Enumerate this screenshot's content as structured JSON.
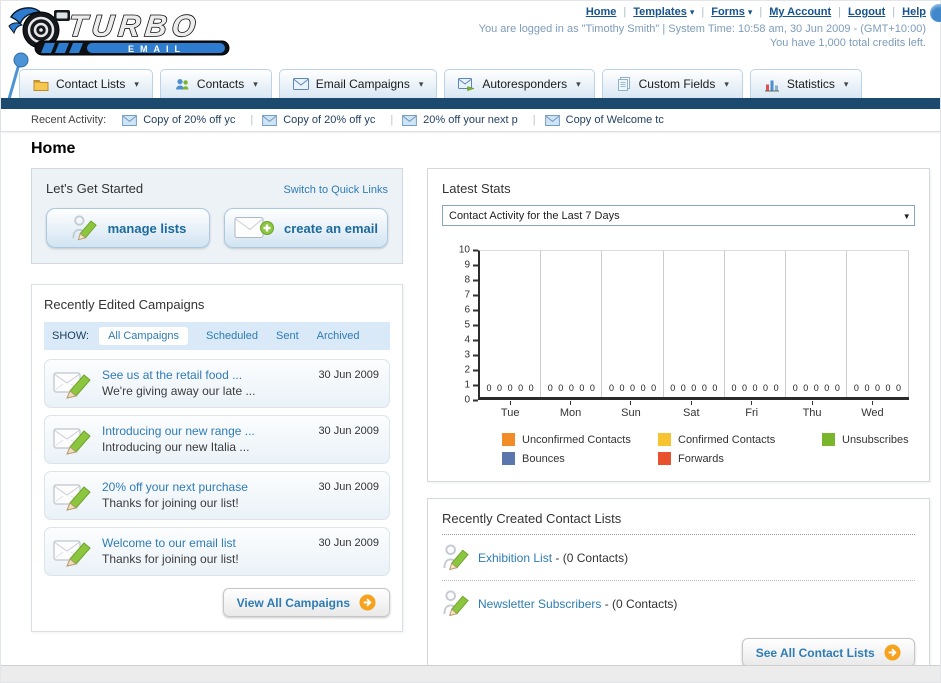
{
  "brand": {
    "title": "TURBO",
    "subtitle": "EMAIL"
  },
  "header": {
    "links": [
      {
        "label": "Home",
        "dropdown": false
      },
      {
        "label": "Templates",
        "dropdown": true
      },
      {
        "label": "Forms",
        "dropdown": true
      },
      {
        "label": "My Account",
        "dropdown": false
      },
      {
        "label": "Logout",
        "dropdown": false
      },
      {
        "label": "Help",
        "dropdown": false
      }
    ],
    "status_line1": "You are logged in as \"Timothy Smith\" | System Time: 10:58 am, 30 Jun 2009 - (GMT+10:00)",
    "status_line2": "You have 1,000 total credits left."
  },
  "nav_tabs": [
    {
      "label": "Contact Lists",
      "icon": "folder-icon"
    },
    {
      "label": "Contacts",
      "icon": "contacts-icon"
    },
    {
      "label": "Email Campaigns",
      "icon": "email-icon"
    },
    {
      "label": "Autoresponders",
      "icon": "autoresponder-icon"
    },
    {
      "label": "Custom Fields",
      "icon": "custom-fields-icon"
    },
    {
      "label": "Statistics",
      "icon": "statistics-icon"
    }
  ],
  "recent_activity": {
    "label": "Recent Activity:",
    "items": [
      {
        "title": "Copy of 20% off yc",
        "icon": "envelope-icon"
      },
      {
        "title": "Copy of 20% off yc",
        "icon": "envelope-icon"
      },
      {
        "title": "20% off your next p",
        "icon": "envelope-icon"
      },
      {
        "title": "Copy of Welcome tc",
        "icon": "envelope-icon"
      }
    ]
  },
  "page_title": "Home",
  "get_started": {
    "title": "Let's Get Started",
    "switch_link": "Switch to Quick Links",
    "buttons": [
      {
        "label": "manage lists",
        "icon": "manage-lists-icon"
      },
      {
        "label": "create an email",
        "icon": "create-email-icon"
      }
    ]
  },
  "campaigns": {
    "title": "Recently Edited Campaigns",
    "show_label": "SHOW:",
    "filters": [
      {
        "label": "All Campaigns",
        "active": true
      },
      {
        "label": "Scheduled",
        "active": false
      },
      {
        "label": "Sent",
        "active": false
      },
      {
        "label": "Archived",
        "active": false
      }
    ],
    "items": [
      {
        "title": "See us at the retail food ...",
        "subtitle": "We're giving away our late ...",
        "date": "30 Jun 2009",
        "icon": "campaign-edit-icon"
      },
      {
        "title": "Introducing our new range ...",
        "subtitle": "Introducing our new Italia ...",
        "date": "30 Jun 2009",
        "icon": "campaign-edit-icon"
      },
      {
        "title": "20% off your next purchase",
        "subtitle": "Thanks for joining our list!",
        "date": "30 Jun 2009",
        "icon": "campaign-edit-icon"
      },
      {
        "title": "Welcome to our email list",
        "subtitle": "Thanks for joining our list!",
        "date": "30 Jun 2009",
        "icon": "campaign-edit-icon"
      }
    ],
    "view_all_label": "View All Campaigns"
  },
  "stats": {
    "title": "Latest Stats",
    "selected_option": "Contact Activity for the Last 7 Days"
  },
  "chart_data": {
    "type": "bar",
    "title": "Contact Activity for the Last 7 Days",
    "categories": [
      "Tue",
      "Mon",
      "Sun",
      "Sat",
      "Fri",
      "Thu",
      "Wed"
    ],
    "series": [
      {
        "name": "Unconfirmed Contacts",
        "color": "#F28C28",
        "values": [
          0,
          0,
          0,
          0,
          0,
          0,
          0
        ]
      },
      {
        "name": "Confirmed Contacts",
        "color": "#F7C331",
        "values": [
          0,
          0,
          0,
          0,
          0,
          0,
          0
        ]
      },
      {
        "name": "Unsubscribes",
        "color": "#7AB52C",
        "values": [
          0,
          0,
          0,
          0,
          0,
          0,
          0
        ]
      },
      {
        "name": "Bounces",
        "color": "#5B76AC",
        "values": [
          0,
          0,
          0,
          0,
          0,
          0,
          0
        ]
      },
      {
        "name": "Forwards",
        "color": "#E8502E",
        "values": [
          0,
          0,
          0,
          0,
          0,
          0,
          0
        ]
      }
    ],
    "ylim": [
      0,
      10
    ],
    "ytick_step": 1,
    "grid": "vertical",
    "legend_position": "bottom",
    "value_labels_shown": true
  },
  "contact_lists": {
    "title": "Recently Created Contact Lists",
    "items": [
      {
        "name": "Exhibition List",
        "suffix": "- (0 Contacts)",
        "icon": "list-edit-icon"
      },
      {
        "name": "Newsletter Subscribers",
        "suffix": "- (0 Contacts)",
        "icon": "list-edit-icon"
      }
    ],
    "see_all_label": "See All Contact Lists"
  }
}
